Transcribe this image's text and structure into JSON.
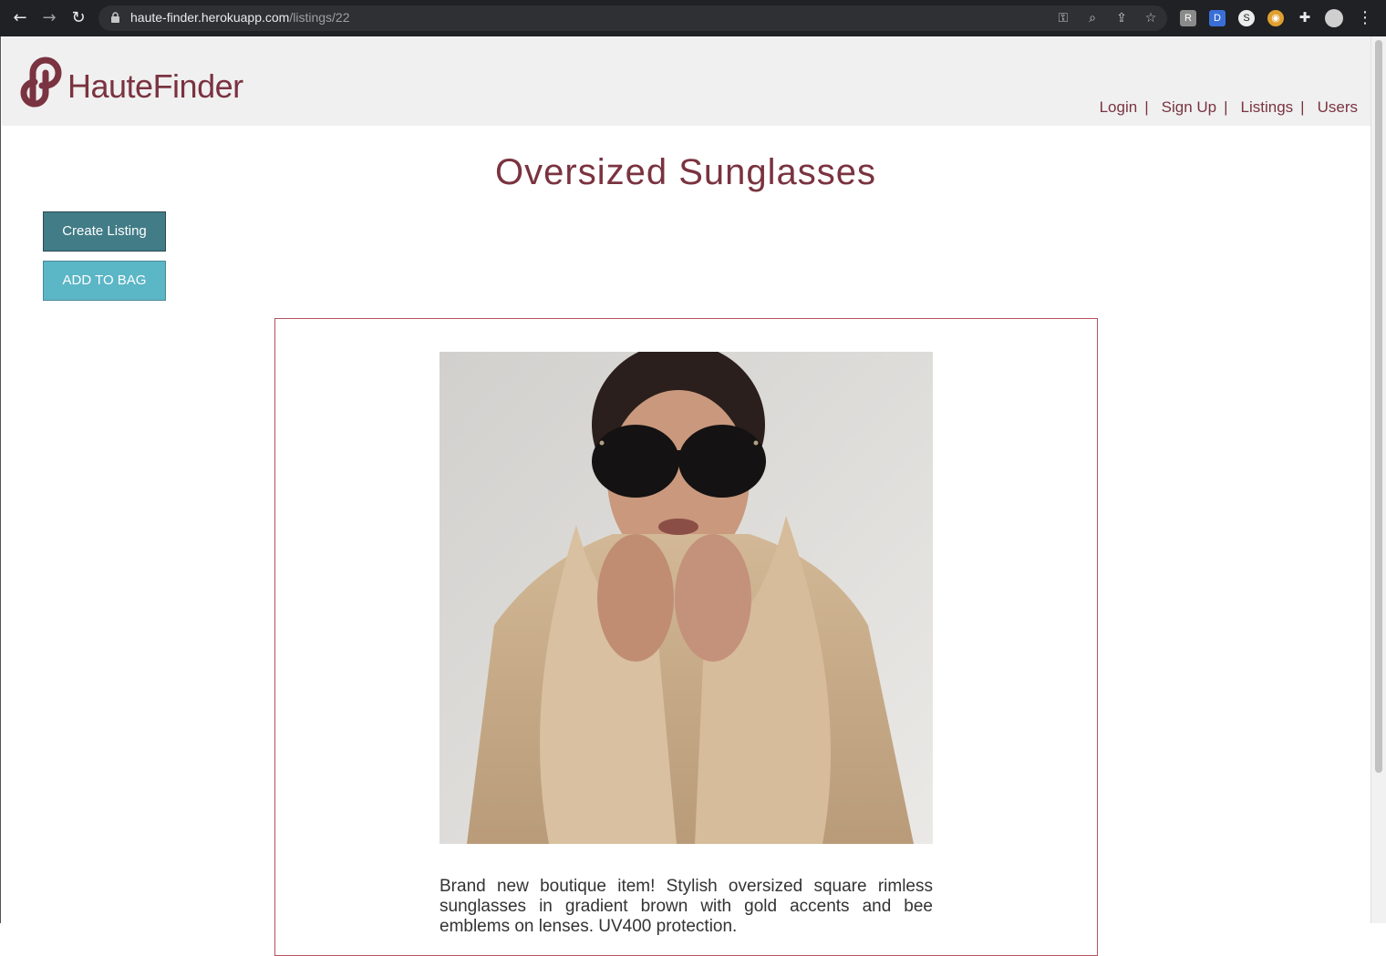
{
  "browser": {
    "url_host": "haute-finder.herokuapp.com",
    "url_path": "/listings/22",
    "icons": [
      "back-icon",
      "forward-icon",
      "reload-icon",
      "lock-icon",
      "key-icon",
      "zoom-icon",
      "share-icon",
      "star-icon",
      "extensions-icon",
      "menu-icon"
    ]
  },
  "site": {
    "brand": "HauteFinder",
    "brand_color": "#7a3340",
    "nav": [
      {
        "label": "Login"
      },
      {
        "label": "Sign Up"
      },
      {
        "label": "Listings"
      },
      {
        "label": "Users"
      }
    ],
    "nav_separator": "|"
  },
  "listing": {
    "title": "Oversized Sunglasses",
    "create_button": "Create Listing",
    "bag_button": "ADD TO BAG",
    "description": "Brand new boutique item! Stylish oversized square rimless sunglasses in gradient brown with gold accents and bee emblems on lenses. UV400 protection."
  },
  "colors": {
    "create_button": "#417c87",
    "bag_button": "#5bb6c6",
    "card_border": "#b5525f"
  }
}
